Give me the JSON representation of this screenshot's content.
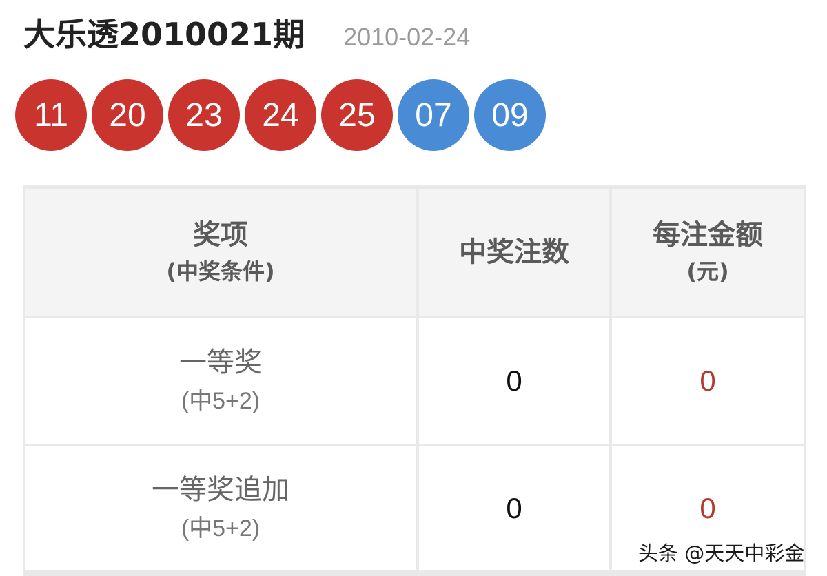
{
  "header": {
    "title": "大乐透2010021期",
    "date": "2010-02-24"
  },
  "balls": {
    "front": [
      "11",
      "20",
      "23",
      "24",
      "25"
    ],
    "back": [
      "07",
      "09"
    ],
    "colors": {
      "front": "#c9342f",
      "back": "#4a8bd6"
    }
  },
  "table": {
    "headers": {
      "prize": {
        "main": "奖项",
        "sub": "(中奖条件)"
      },
      "count": {
        "main": "中奖注数"
      },
      "amount": {
        "main": "每注金额",
        "sub": "(元)"
      }
    },
    "rows": [
      {
        "name": "一等奖",
        "condition": "(中5+2)",
        "count": "0",
        "amount": "0"
      },
      {
        "name": "一等奖追加",
        "condition": "(中5+2)",
        "count": "0",
        "amount": "0"
      }
    ]
  },
  "watermark": "头条 @天天中彩金"
}
